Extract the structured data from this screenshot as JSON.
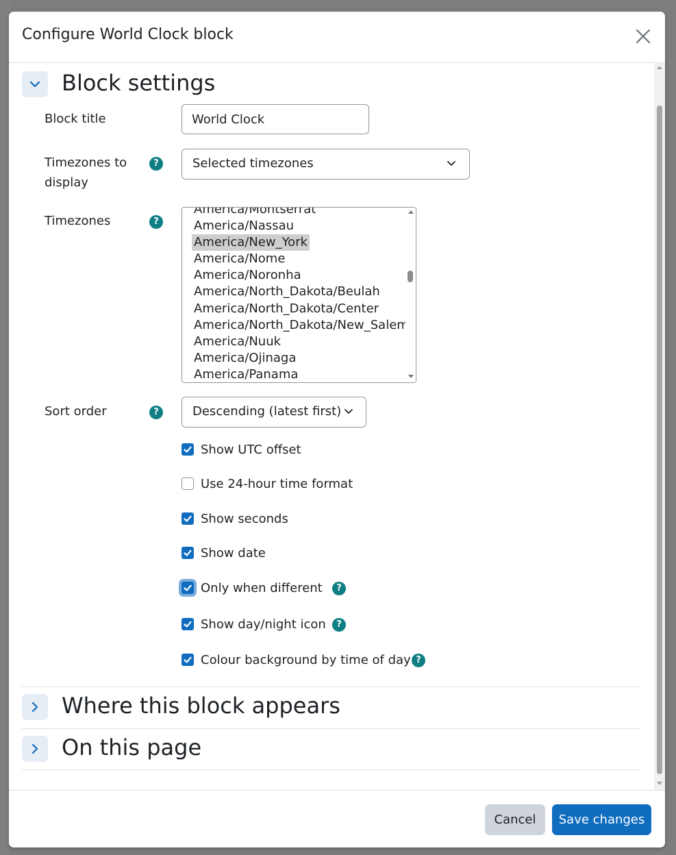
{
  "modal": {
    "title": "Configure World Clock block",
    "close_label": "Close"
  },
  "sections": {
    "block_settings": "Block settings",
    "where_appears": "Where this block appears",
    "on_this_page": "On this page"
  },
  "fields": {
    "block_title": {
      "label": "Block title",
      "value": "World Clock"
    },
    "timezones_to_display": {
      "label_line1": "Timezones to",
      "label_line2": "display",
      "selected": "Selected timezones"
    },
    "timezones": {
      "label": "Timezones",
      "items": [
        "America/Montserrat",
        "America/Nassau",
        "America/New_York",
        "America/Nome",
        "America/Noronha",
        "America/North_Dakota/Beulah",
        "America/North_Dakota/Center",
        "America/North_Dakota/New_Salem",
        "America/Nuuk",
        "America/Ojinaga",
        "America/Panama"
      ],
      "selected": "America/New_York"
    },
    "sort_order": {
      "label": "Sort order",
      "selected": "Descending (latest first)"
    }
  },
  "checkboxes": [
    {
      "label": "Show UTC offset",
      "checked": true
    },
    {
      "label": "Use 24-hour time format",
      "checked": false
    },
    {
      "label": "Show seconds",
      "checked": true
    },
    {
      "label": "Show date",
      "checked": true
    },
    {
      "label": "Only when different",
      "checked": true,
      "help": true
    },
    {
      "label": "Show day/night icon",
      "checked": true,
      "help": true
    },
    {
      "label": "Colour background by time of day",
      "checked": true,
      "help": true
    }
  ],
  "help_icon_text": "?",
  "footer": {
    "cancel": "Cancel",
    "save": "Save changes"
  },
  "colors": {
    "primary": "#0f6cbf",
    "help": "#0f7f85",
    "secondary_button": "#ced4da"
  },
  "icons": {
    "close": "close-icon",
    "chevron_down": "chevron-down-icon",
    "chevron_right": "chevron-right-icon",
    "help": "question-circle-icon",
    "check": "check-icon"
  }
}
